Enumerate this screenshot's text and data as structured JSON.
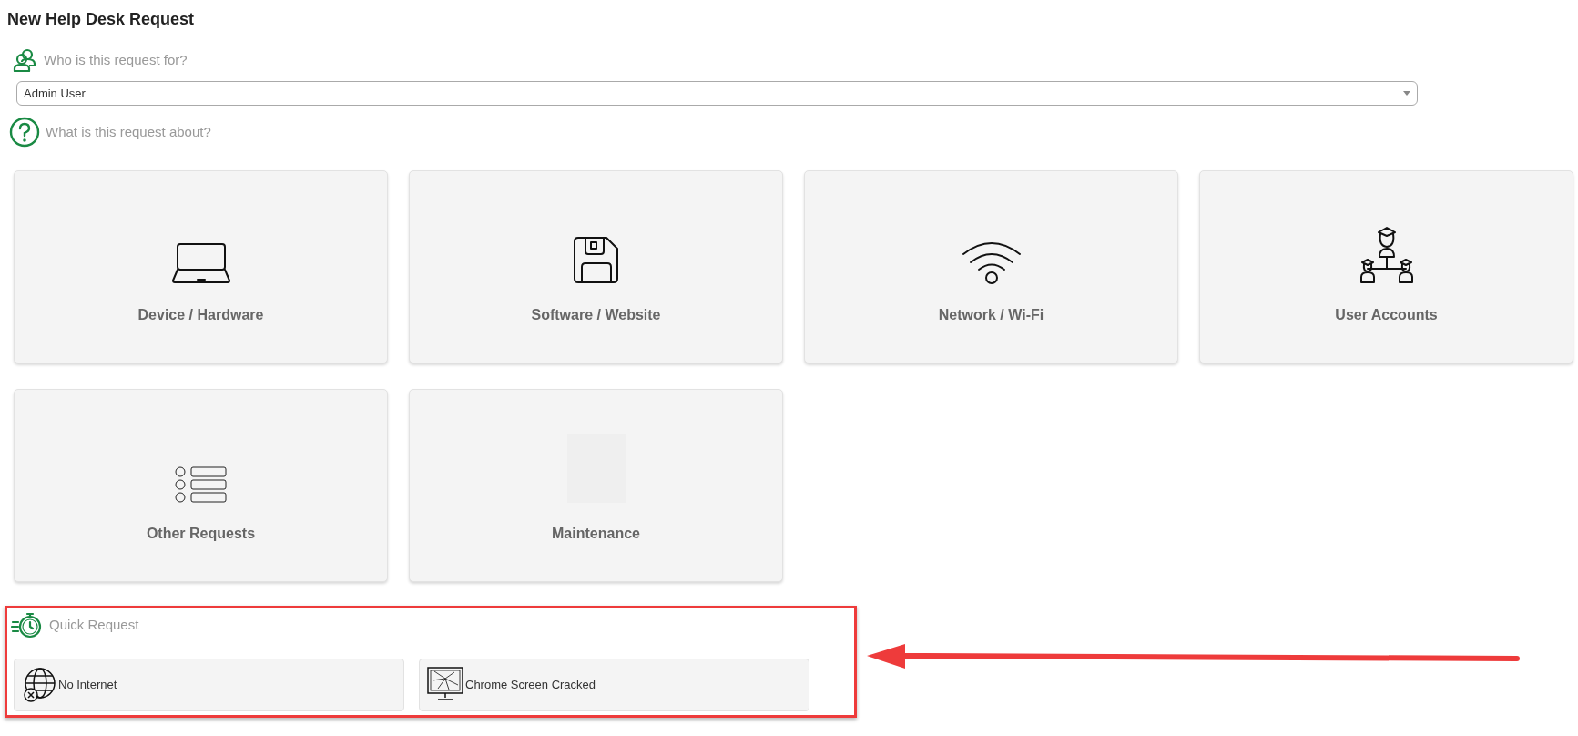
{
  "title": "New Help Desk Request",
  "who": {
    "label": "Who is this request for?",
    "select": {
      "value": "Admin User"
    }
  },
  "about": {
    "label": "What is this request about?"
  },
  "categories": [
    {
      "label": "Device / Hardware"
    },
    {
      "label": "Software / Website"
    },
    {
      "label": "Network / Wi-Fi"
    },
    {
      "label": "User Accounts"
    },
    {
      "label": "Other Requests"
    },
    {
      "label": "Maintenance"
    }
  ],
  "quick": {
    "label": "Quick Request",
    "items": [
      {
        "label": "No Internet"
      },
      {
        "label": "Chrome Screen Cracked"
      }
    ]
  }
}
